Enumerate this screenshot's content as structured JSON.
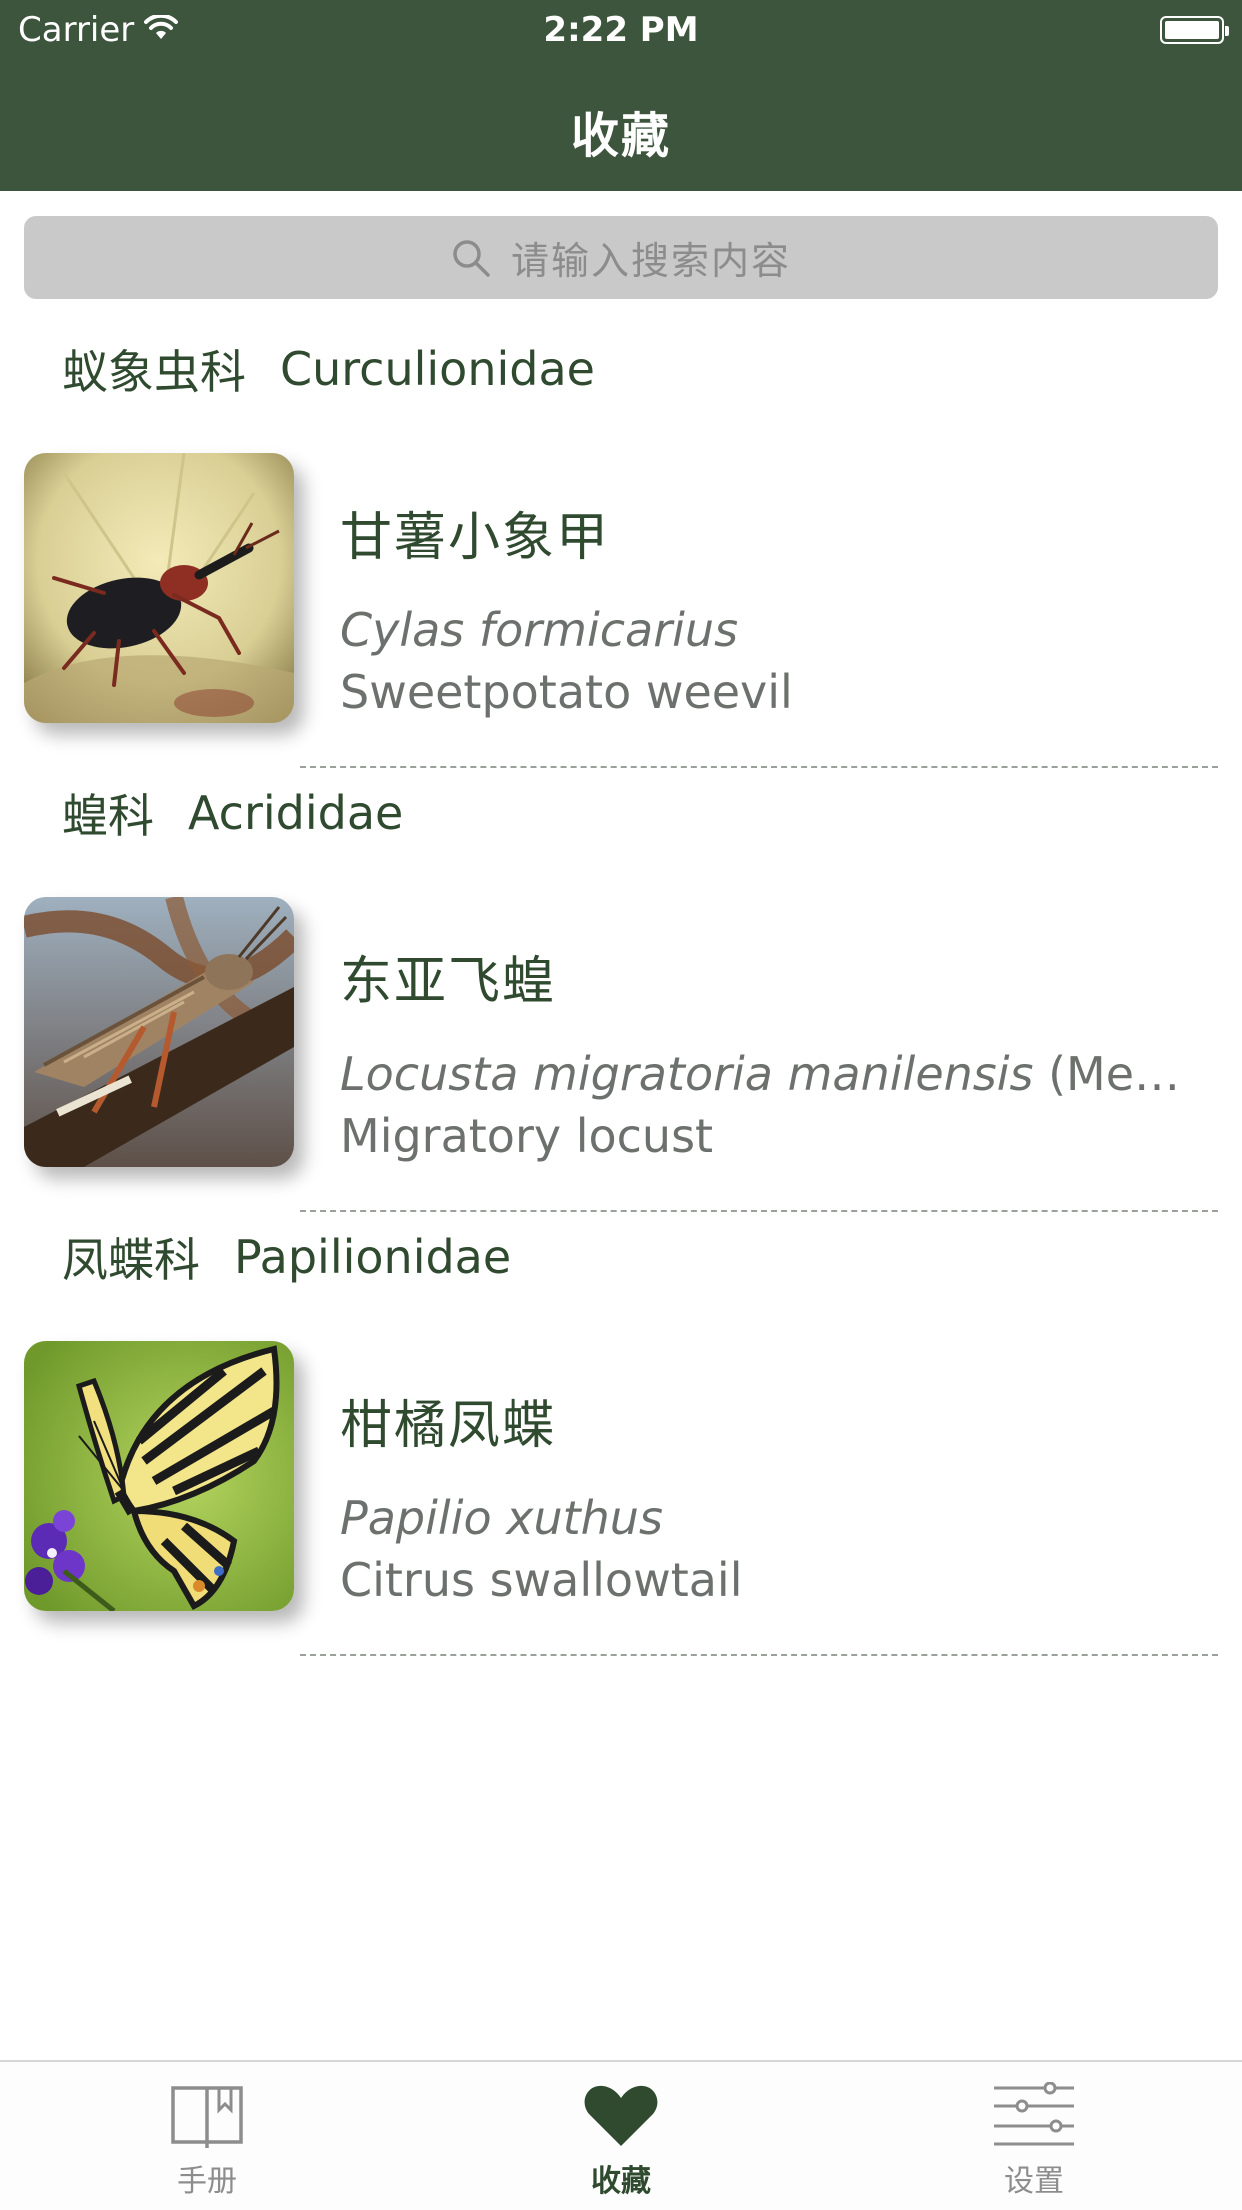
{
  "status_bar": {
    "carrier": "Carrier",
    "time": "2:22 PM"
  },
  "nav": {
    "title": "收藏"
  },
  "search": {
    "placeholder": "请输入搜索内容"
  },
  "sections": [
    {
      "family_cn": "蚁象虫科",
      "family_latin": "Curculionidae",
      "items": [
        {
          "name_cn": "甘薯小象甲",
          "scientific": "Cylas formicarius",
          "author": "",
          "common": "Sweetpotato weevil",
          "image_icon": "weevil-photo"
        }
      ]
    },
    {
      "family_cn": "蝗科",
      "family_latin": "Acrididae",
      "items": [
        {
          "name_cn": "东亚飞蝗",
          "scientific": "Locusta migratoria manilensis",
          "author": " (Mey...",
          "common": "Migratory locust",
          "image_icon": "locust-photo"
        }
      ]
    },
    {
      "family_cn": "凤蝶科",
      "family_latin": "Papilionidae",
      "items": [
        {
          "name_cn": "柑橘凤蝶",
          "scientific": "Papilio xuthus",
          "author": "",
          "common": "Citrus swallowtail",
          "image_icon": "swallowtail-photo"
        }
      ]
    }
  ],
  "tab_bar": {
    "tabs": [
      {
        "label": "手册",
        "icon": "book-icon",
        "active": false
      },
      {
        "label": "收藏",
        "icon": "heart-icon",
        "active": true
      },
      {
        "label": "设置",
        "icon": "sliders-icon",
        "active": false
      }
    ]
  },
  "colors": {
    "nav_bg": "#3d553d",
    "accent": "#2f4a2f",
    "search_bg": "#c9c9c9",
    "secondary_text": "#6d716d"
  }
}
